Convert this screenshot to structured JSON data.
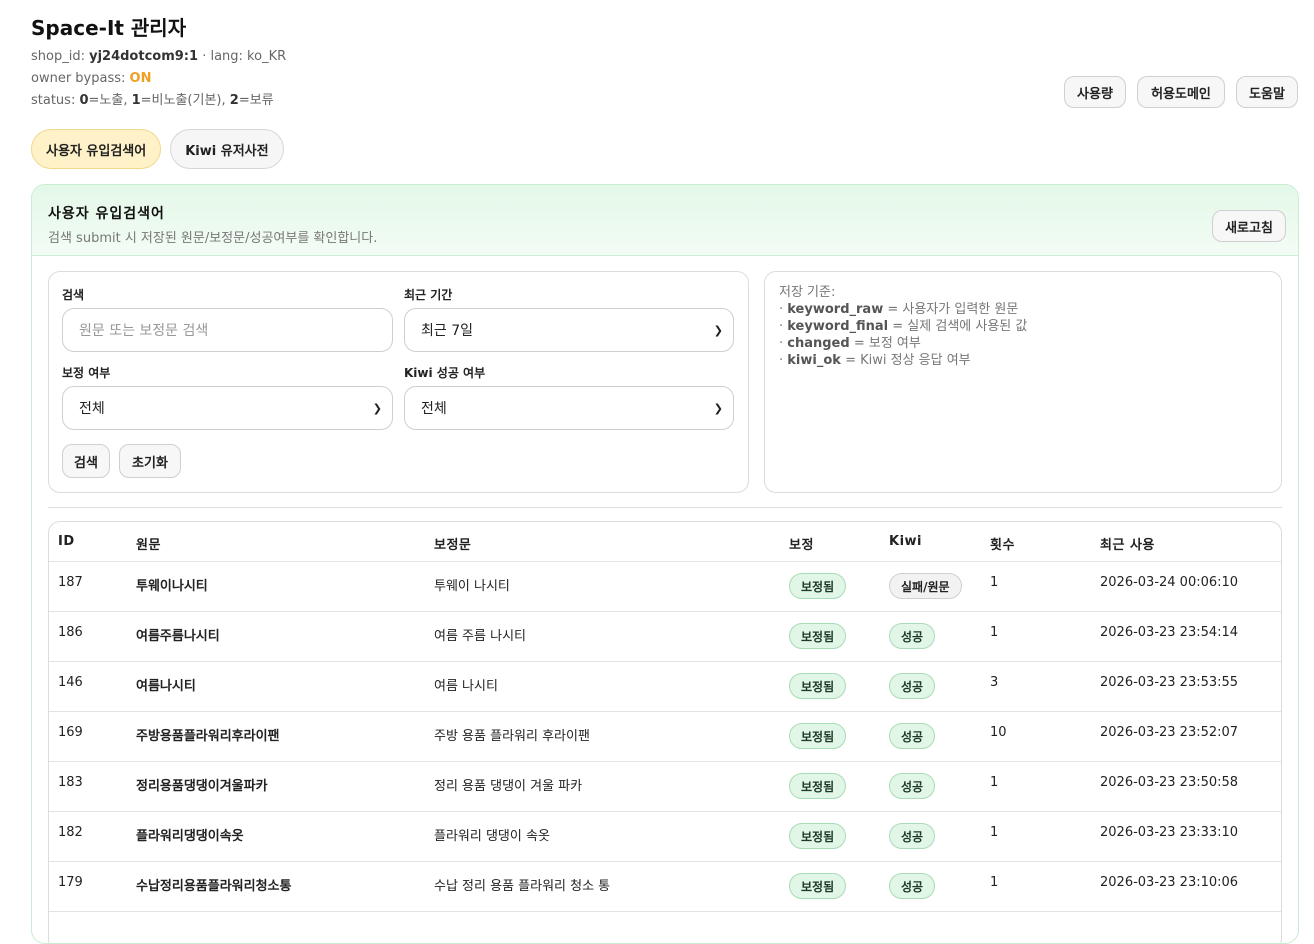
{
  "app": {
    "title": "Space-It 관리자",
    "shop_id_label": "shop_id:",
    "shop_id": "yj24dotcom9:1",
    "lang_label": "· lang: ko_KR",
    "bypass_label": "owner bypass:",
    "bypass_value": "ON",
    "status_label": "status:",
    "status_0": "0",
    "status_0_text": "=노출,",
    "status_1": "1",
    "status_1_text": "=비노출(기본),",
    "status_2": "2",
    "status_2_text": "=보류"
  },
  "top_actions": {
    "usage": "사용량",
    "domains": "허용도메인",
    "help": "도움말"
  },
  "tabs": [
    {
      "label": "사용자 유입검색어"
    },
    {
      "label": "Kiwi 유저사전"
    }
  ],
  "panel": {
    "title": "사용자 유입검색어",
    "subtitle": "검색 submit 시 저장된 원문/보정문/성공여부를 확인합니다.",
    "refresh": "새로고침"
  },
  "filters": {
    "search_label": "검색",
    "search_placeholder": "원문 또는 보정문 검색",
    "period_label": "최근 기간",
    "period_value": "최근 7일",
    "changed_label": "보정 여부",
    "changed_value": "전체",
    "kiwi_label": "Kiwi 성공 여부",
    "kiwi_value": "전체",
    "search_button": "검색",
    "reset_button": "초기화"
  },
  "notes": {
    "heading": "저장 기준:",
    "items": [
      {
        "key": "keyword_raw",
        "text": "= 사용자가 입력한 원문"
      },
      {
        "key": "keyword_final",
        "text": "= 실제 검색에 사용된 값"
      },
      {
        "key": "changed",
        "text": "= 보정 여부"
      },
      {
        "key": "kiwi_ok",
        "text": "= Kiwi 정상 응답 여부"
      }
    ]
  },
  "table": {
    "headers": {
      "id": "ID",
      "raw": "원문",
      "final": "보정문",
      "changed": "보정",
      "kiwi": "Kiwi",
      "count": "횟수",
      "last": "최근 사용"
    },
    "rows": [
      {
        "id": "187",
        "raw": "투웨이나시티",
        "final": "투웨이 나시티",
        "changed": "보정됨",
        "kiwi": "실패/원문",
        "count": "1",
        "last": "2026-03-24 00:06:10"
      },
      {
        "id": "186",
        "raw": "여름주름나시티",
        "final": "여름 주름 나시티",
        "changed": "보정됨",
        "kiwi": "성공",
        "count": "1",
        "last": "2026-03-23 23:54:14"
      },
      {
        "id": "146",
        "raw": "여름나시티",
        "final": "여름 나시티",
        "changed": "보정됨",
        "kiwi": "성공",
        "count": "3",
        "last": "2026-03-23 23:53:55"
      },
      {
        "id": "169",
        "raw": "주방용품플라워리후라이팬",
        "final": "주방 용품 플라워리 후라이팬",
        "changed": "보정됨",
        "kiwi": "성공",
        "count": "10",
        "last": "2026-03-23 23:52:07"
      },
      {
        "id": "183",
        "raw": "정리용품댕댕이겨울파카",
        "final": "정리 용품 댕댕이 겨울 파카",
        "changed": "보정됨",
        "kiwi": "성공",
        "count": "1",
        "last": "2026-03-23 23:50:58"
      },
      {
        "id": "182",
        "raw": "플라워리댕댕이속옷",
        "final": "플라워리 댕댕이 속옷",
        "changed": "보정됨",
        "kiwi": "성공",
        "count": "1",
        "last": "2026-03-23 23:33:10"
      },
      {
        "id": "179",
        "raw": "수납정리용품플라워리청소통",
        "final": "수납 정리 용품 플라워리 청소 통",
        "changed": "보정됨",
        "kiwi": "성공",
        "count": "1",
        "last": "2026-03-23 23:10:06"
      }
    ]
  }
}
